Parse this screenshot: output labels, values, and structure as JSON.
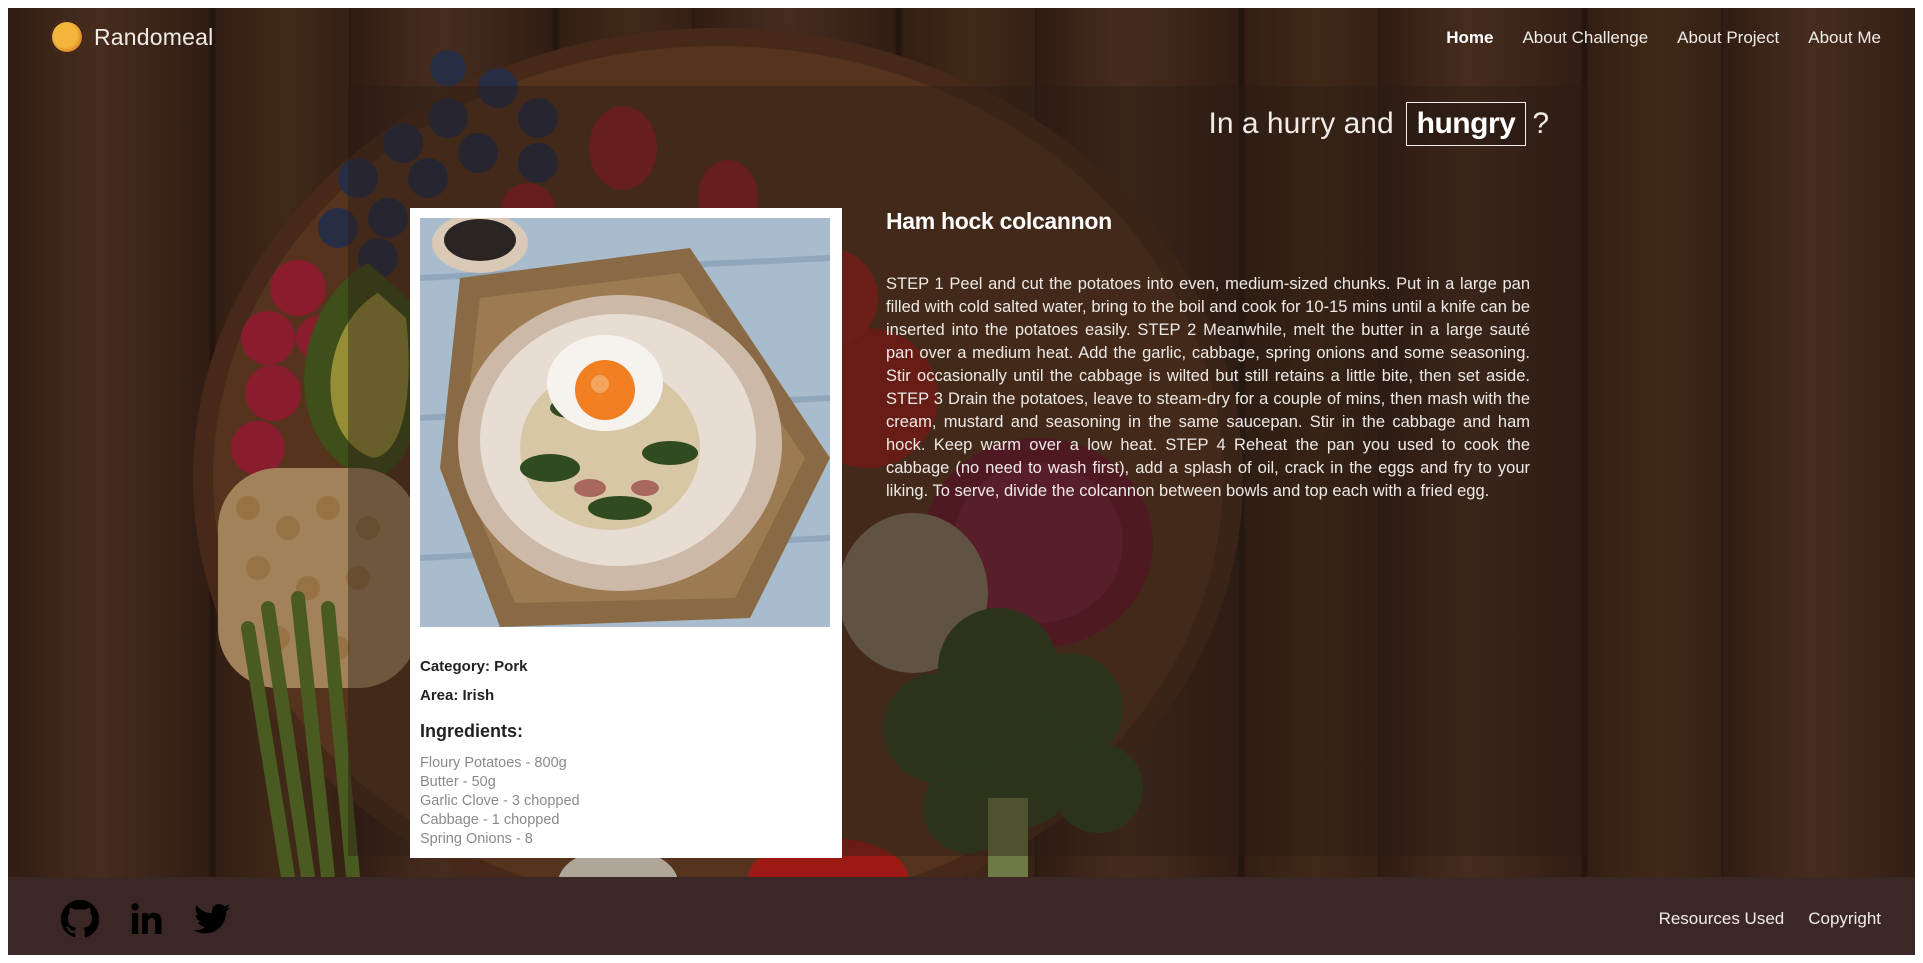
{
  "navbar": {
    "brand": "Randomeal",
    "links": [
      {
        "label": "Home",
        "active": true
      },
      {
        "label": "About Challenge",
        "active": false
      },
      {
        "label": "About Project",
        "active": false
      },
      {
        "label": "About Me",
        "active": false
      }
    ]
  },
  "tagline": {
    "prefix": "In a hurry and",
    "highlight": "hungry",
    "suffix": "?"
  },
  "recipe": {
    "title": "Ham hock colcannon",
    "category_label": "Category: Pork",
    "area_label": "Area: Irish",
    "ingredients_title": "Ingredients:",
    "ingredients": [
      "Floury Potatoes - 800g",
      "Butter - 50g",
      "Garlic Clove - 3 chopped",
      "Cabbage - 1 chopped",
      "Spring Onions - 8"
    ],
    "instructions": "STEP 1 Peel and cut the potatoes into even, medium-sized chunks. Put in a large pan filled with cold salted water, bring to the boil and cook for 10-15 mins until a knife can be inserted into the potatoes easily. STEP 2 Meanwhile, melt the butter in a large sauté pan over a medium heat. Add the garlic, cabbage, spring onions and some seasoning. Stir occasionally until the cabbage is wilted but still retains a little bite, then set aside. STEP 3 Drain the potatoes, leave to steam-dry for a couple of mins, then mash with the cream, mustard and seasoning in the same saucepan. Stir in the cabbage and ham hock. Keep warm over a low heat. STEP 4 Reheat the pan you used to cook the cabbage (no need to wash first), add a splash of oil, crack in the eggs and fry to your liking. To serve, divide the colcannon between bowls and top each with a fried egg."
  },
  "footer": {
    "social_icons": [
      "github-icon",
      "linkedin-icon",
      "twitter-icon"
    ],
    "links": [
      "Resources Used",
      "Copyright"
    ]
  },
  "colors": {
    "footer_bg": "#3b2826",
    "text_light": "#f0ece8",
    "card_bg": "#ffffff"
  }
}
